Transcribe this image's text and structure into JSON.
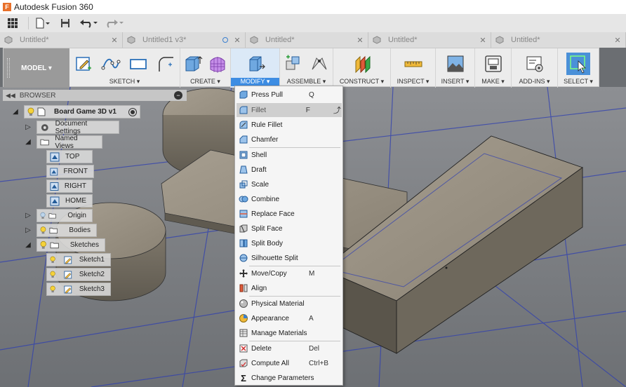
{
  "window": {
    "title": "Autodesk Fusion 360"
  },
  "tabs": [
    {
      "label": "Untitled*"
    },
    {
      "label": "Untitled1 v3*"
    },
    {
      "label": "Untitled*"
    },
    {
      "label": "Untitled*"
    },
    {
      "label": "Untitled*"
    }
  ],
  "toolbar": {
    "workspace_label": "MODEL ▾",
    "groups": {
      "sketch": "SKETCH ▾",
      "create": "CREATE ▾",
      "modify": "MODIFY ▾",
      "assemble": "ASSEMBLE ▾",
      "construct": "CONSTRUCT ▾",
      "inspect": "INSPECT ▾",
      "insert": "INSERT ▾",
      "make": "MAKE ▾",
      "addins": "ADD-INS ▾",
      "select": "SELECT ▾"
    }
  },
  "browser": {
    "title": "BROWSER",
    "root": "Board Game 3D v1",
    "document_settings": "Document Settings",
    "named_views": "Named Views",
    "views": [
      "TOP",
      "FRONT",
      "RIGHT",
      "HOME"
    ],
    "origin": "Origin",
    "bodies": "Bodies",
    "sketches": "Sketches",
    "sketch_items": [
      "Sketch1",
      "Sketch2",
      "Sketch3"
    ]
  },
  "modify_menu": {
    "items": [
      {
        "label": "Press Pull",
        "shortcut": "Q"
      },
      {
        "label": "Fillet",
        "shortcut": "F"
      },
      {
        "label": "Rule Fillet",
        "shortcut": ""
      },
      {
        "label": "Chamfer",
        "shortcut": ""
      },
      {
        "label": "Shell",
        "shortcut": ""
      },
      {
        "label": "Draft",
        "shortcut": ""
      },
      {
        "label": "Scale",
        "shortcut": ""
      },
      {
        "label": "Combine",
        "shortcut": ""
      },
      {
        "label": "Replace Face",
        "shortcut": ""
      },
      {
        "label": "Split Face",
        "shortcut": ""
      },
      {
        "label": "Split Body",
        "shortcut": ""
      },
      {
        "label": "Silhouette Split",
        "shortcut": ""
      },
      {
        "label": "Move/Copy",
        "shortcut": "M"
      },
      {
        "label": "Align",
        "shortcut": ""
      },
      {
        "label": "Physical Material",
        "shortcut": ""
      },
      {
        "label": "Appearance",
        "shortcut": "A"
      },
      {
        "label": "Manage Materials",
        "shortcut": ""
      },
      {
        "label": "Delete",
        "shortcut": "Del"
      },
      {
        "label": "Compute All",
        "shortcut": "Ctrl+B"
      },
      {
        "label": "Change Parameters",
        "shortcut": ""
      }
    ]
  },
  "colors": {
    "accent": "#3d8de3",
    "model_body": "#8f8779",
    "grid_line": "#2f3fb0",
    "background": "#6b6e72"
  }
}
